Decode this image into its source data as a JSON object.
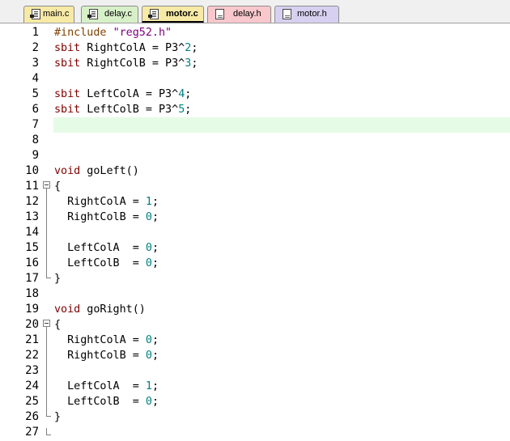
{
  "tabs": [
    {
      "label": "main.c",
      "kind": "c",
      "color": "#f7e9a6",
      "active": false
    },
    {
      "label": "delay.c",
      "kind": "c",
      "color": "#d8f0c8",
      "active": false
    },
    {
      "label": "motor.c",
      "kind": "c",
      "color": "#f7e9a6",
      "active": true
    },
    {
      "label": "delay.h",
      "kind": "h",
      "color": "#f8c8cc",
      "active": false
    },
    {
      "label": "motor.h",
      "kind": "h",
      "color": "#d8d0f0",
      "active": false
    }
  ],
  "current_line": 7,
  "colors": {
    "keyword": "#800000",
    "preprocessor": "#804000",
    "string": "#800080",
    "number": "#008080",
    "current_line": "#e6fbe6"
  },
  "lines": [
    {
      "n": "1",
      "tokens": [
        {
          "t": "#include ",
          "c": "pp"
        },
        {
          "t": "\"reg52.h\"",
          "c": "str"
        }
      ]
    },
    {
      "n": "2",
      "tokens": [
        {
          "t": "sbit",
          "c": "kw"
        },
        {
          "t": " RightColA = P3^",
          "c": ""
        },
        {
          "t": "2",
          "c": "num"
        },
        {
          "t": ";",
          "c": ""
        }
      ]
    },
    {
      "n": "3",
      "tokens": [
        {
          "t": "sbit",
          "c": "kw"
        },
        {
          "t": " RightColB = P3^",
          "c": ""
        },
        {
          "t": "3",
          "c": "num"
        },
        {
          "t": ";",
          "c": ""
        }
      ]
    },
    {
      "n": "4",
      "tokens": []
    },
    {
      "n": "5",
      "tokens": [
        {
          "t": "sbit",
          "c": "kw"
        },
        {
          "t": " LeftColA = P3^",
          "c": ""
        },
        {
          "t": "4",
          "c": "num"
        },
        {
          "t": ";",
          "c": ""
        }
      ]
    },
    {
      "n": "6",
      "tokens": [
        {
          "t": "sbit",
          "c": "kw"
        },
        {
          "t": " LeftColB = P3^",
          "c": ""
        },
        {
          "t": "5",
          "c": "num"
        },
        {
          "t": ";",
          "c": ""
        }
      ]
    },
    {
      "n": "7",
      "tokens": []
    },
    {
      "n": "8",
      "tokens": []
    },
    {
      "n": "9",
      "tokens": []
    },
    {
      "n": "10",
      "tokens": [
        {
          "t": "void",
          "c": "kw"
        },
        {
          "t": " goLeft()",
          "c": ""
        }
      ]
    },
    {
      "n": "11",
      "tokens": [
        {
          "t": "{",
          "c": ""
        }
      ]
    },
    {
      "n": "12",
      "tokens": [
        {
          "t": "  RightColA = ",
          "c": ""
        },
        {
          "t": "1",
          "c": "num"
        },
        {
          "t": ";",
          "c": ""
        }
      ]
    },
    {
      "n": "13",
      "tokens": [
        {
          "t": "  RightColB = ",
          "c": ""
        },
        {
          "t": "0",
          "c": "num"
        },
        {
          "t": ";",
          "c": ""
        }
      ]
    },
    {
      "n": "14",
      "tokens": []
    },
    {
      "n": "15",
      "tokens": [
        {
          "t": "  LeftColA  = ",
          "c": ""
        },
        {
          "t": "0",
          "c": "num"
        },
        {
          "t": ";",
          "c": ""
        }
      ]
    },
    {
      "n": "16",
      "tokens": [
        {
          "t": "  LeftColB  = ",
          "c": ""
        },
        {
          "t": "0",
          "c": "num"
        },
        {
          "t": ";",
          "c": ""
        }
      ]
    },
    {
      "n": "17",
      "tokens": [
        {
          "t": "}",
          "c": ""
        }
      ]
    },
    {
      "n": "18",
      "tokens": []
    },
    {
      "n": "19",
      "tokens": [
        {
          "t": "void",
          "c": "kw"
        },
        {
          "t": " goRight()",
          "c": ""
        }
      ]
    },
    {
      "n": "20",
      "tokens": [
        {
          "t": "{",
          "c": ""
        }
      ]
    },
    {
      "n": "21",
      "tokens": [
        {
          "t": "  RightColA = ",
          "c": ""
        },
        {
          "t": "0",
          "c": "num"
        },
        {
          "t": ";",
          "c": ""
        }
      ]
    },
    {
      "n": "22",
      "tokens": [
        {
          "t": "  RightColB = ",
          "c": ""
        },
        {
          "t": "0",
          "c": "num"
        },
        {
          "t": ";",
          "c": ""
        }
      ]
    },
    {
      "n": "23",
      "tokens": []
    },
    {
      "n": "24",
      "tokens": [
        {
          "t": "  LeftColA  = ",
          "c": ""
        },
        {
          "t": "1",
          "c": "num"
        },
        {
          "t": ";",
          "c": ""
        }
      ]
    },
    {
      "n": "25",
      "tokens": [
        {
          "t": "  LeftColB  = ",
          "c": ""
        },
        {
          "t": "0",
          "c": "num"
        },
        {
          "t": ";",
          "c": ""
        }
      ]
    },
    {
      "n": "26",
      "tokens": [
        {
          "t": "}",
          "c": ""
        }
      ]
    },
    {
      "n": "27",
      "tokens": []
    }
  ]
}
